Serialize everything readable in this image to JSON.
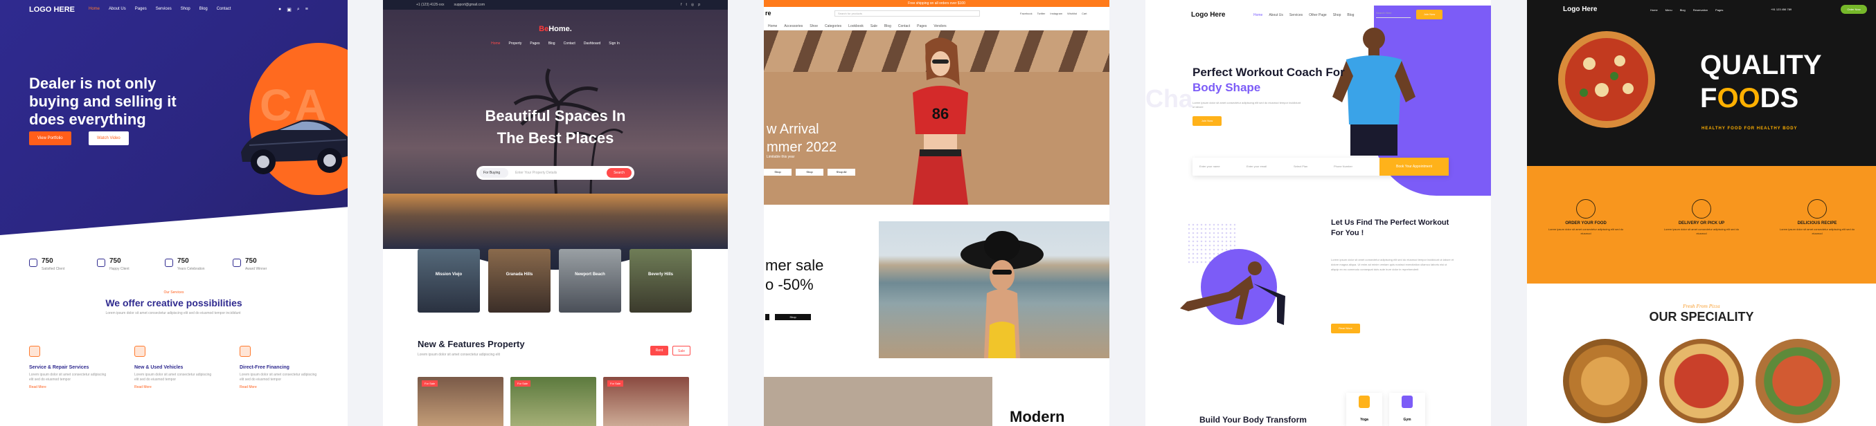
{
  "panel1": {
    "logo": "LOGO HERE",
    "nav": [
      "Home",
      "About Us",
      "Pages",
      "Services",
      "Shop",
      "Blog",
      "Contact"
    ],
    "headline": "Dealer is not only buying and selling it does everything",
    "btn_primary": "View Portfolio",
    "btn_secondary": "Watch Video",
    "ghost_text": "CA",
    "stats": [
      {
        "num": "750",
        "lbl": "Satisfied Client"
      },
      {
        "num": "750",
        "lbl": "Happy Client"
      },
      {
        "num": "750",
        "lbl": "Years Celebration"
      },
      {
        "num": "750",
        "lbl": "Award Winner"
      }
    ],
    "section_eyebrow": "Our Services",
    "section_title": "We offer creative possibilities",
    "section_sub": "Lorem ipsum dolor sit amet consectetur adipiscing elit sed do eiusmod tempor incididunt",
    "services": [
      {
        "title": "Service & Repair Services",
        "desc": "Lorem ipsum dolor sit amet consectetur adipiscing elit sed do eiusmod tempor",
        "more": "Read More"
      },
      {
        "title": "New & Used Vehicles",
        "desc": "Lorem ipsum dolor sit amet consectetur adipiscing elit sed do eiusmod tempor",
        "more": "Read More"
      },
      {
        "title": "Direct-Free Financing",
        "desc": "Lorem ipsum dolor sit amet consectetur adipiscing elit sed do eiusmod tempor",
        "more": "Read More"
      }
    ]
  },
  "panel2": {
    "topbar_phone": "+1 (123) 4125-xxx",
    "topbar_email": "support@gmail.com",
    "logo_b": "Be",
    "logo_rest": "Home.",
    "menu": [
      "Home",
      "Property",
      "Pages",
      "Blog",
      "Contact",
      "Dashboard",
      "Sign In"
    ],
    "title_line1": "Beautiful Spaces In",
    "title_line2": "The Best Places",
    "search_type": "For Buying",
    "search_placeholder": "Enter Your Property Details",
    "search_btn": "Search",
    "cards": [
      "Mission Viejo",
      "Granada Hills",
      "Newport Beach",
      "Beverly Hills"
    ],
    "new_title": "New & Features Property",
    "new_sub": "Lorem ipsum dolor sit amet consectetur adipiscing elit",
    "tab_a": "Rent",
    "tab_b": "Sale",
    "prop_tag": "For Sale"
  },
  "panel3": {
    "strip": "Free shipping on all orders over $100",
    "logo": "re",
    "search_placeholder": "Search for products",
    "header_links": [
      "Facebook",
      "Twitter",
      "Instagram",
      "Wishlist",
      "Cart"
    ],
    "menu": [
      "Home",
      "Accessories",
      "Shoe",
      "Categories",
      "Lookbook",
      "Sale",
      "Blog",
      "Contact",
      "Pages",
      "Vendors"
    ],
    "hero_line1": "w Arrival",
    "hero_line2": "mmer 2022",
    "hero_sub": "Limitable this year",
    "hero_btns": [
      "Shop",
      "Shop",
      "Shop All"
    ],
    "sale_line1": "mer sale",
    "sale_line2": "o -50%",
    "sale_btn": "Shop",
    "modern": "Modern"
  },
  "panel4": {
    "logo": "Logo Here",
    "links": [
      "Home",
      "About Us",
      "Services",
      "Other Page",
      "Shop",
      "Blog"
    ],
    "search_placeholder": "Search Here",
    "top_btn": "Join Now",
    "title_plain": "Perfect Workout Coach For ",
    "title_accent": "Body Shape",
    "ghost": "Cha",
    "desc": "Lorem ipsum dolor sit amet consectetur adipiscing elit sed do eiusmod tempor incididunt ut labore",
    "cta": "Join Now",
    "form_fields": [
      "Enter your name",
      "Enter your email",
      "Select Plan",
      "Phone Number"
    ],
    "form_submit": "Book Your Appointment",
    "sec2_title": "Let Us Find The Perfect Workout For You !",
    "sec2_desc": "Lorem ipsum dolor sit amet consectetur adipiscing elit sed do eiusmod tempor incididunt ut labore et dolore magna aliqua. Ut enim ad minim veniam quis nostrud exercitation ullamco laboris nisi ut aliquip ex ea commodo consequat duis aute irure dolor in reprehenderit",
    "sec2_btn": "Read More",
    "bottom_title": "Build Your Body Transform",
    "bottom_cards": [
      "Yoga",
      "Gym"
    ]
  },
  "panel5": {
    "logo": "Logo Here",
    "links": [
      "Home",
      "Menu",
      "Blog",
      "Reservation",
      "Pages"
    ],
    "phone": "+91 123 456 789",
    "btn": "Order Now",
    "quality_1": "QUALITY",
    "quality_2a": "F",
    "quality_2b": "OO",
    "quality_2c": "DS",
    "tagline": "HEALTHY FOOD FOR HEALTHY BODY",
    "features": [
      {
        "t": "ORDER YOUR FOOD",
        "d": "Lorem ipsum dolor sit amet consectetur adipiscing elit sed do eiusmod"
      },
      {
        "t": "DELIVERY OR PICK UP",
        "d": "Lorem ipsum dolor sit amet consectetur adipiscing elit sed do eiusmod"
      },
      {
        "t": "DELICIOUS RECIPE",
        "d": "Lorem ipsum dolor sit amet consectetur adipiscing elit sed do eiusmod"
      }
    ],
    "script": "Fresh From Pizza",
    "speciality": "OUR SPECIALITY"
  }
}
